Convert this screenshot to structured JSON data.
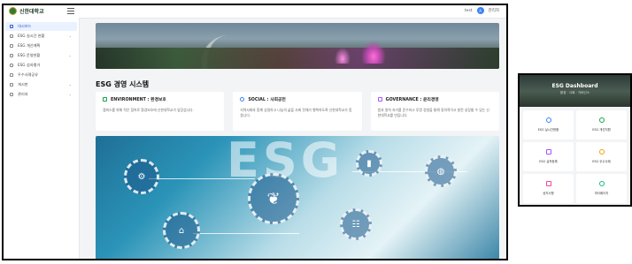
{
  "app": {
    "logo_text": "신한대학교",
    "user_name": "test",
    "user_role": "관리자",
    "avatar_text": "A"
  },
  "sidebar": {
    "items": [
      {
        "label": "대시보드",
        "icon": "dashboard-icon"
      },
      {
        "label": "ESG 실시간 현황",
        "icon": "pie-chart-icon"
      },
      {
        "label": "ESG 개선계획",
        "icon": "lightbulb-icon"
      },
      {
        "label": "ESG 운영현황",
        "icon": "document-icon"
      },
      {
        "label": "ESG 성과평가",
        "icon": "chart-icon"
      },
      {
        "label": "우수사례공유",
        "icon": "star-icon"
      },
      {
        "label": "게시판",
        "icon": "board-icon"
      },
      {
        "label": "관리자",
        "icon": "settings-icon"
      }
    ]
  },
  "main": {
    "section_title": "ESG 경영 시스템",
    "cards": [
      {
        "title": "ENVIRONMENT : 환경보호",
        "body": "캠퍼스를 위해 작은 참여로 환경보호에 신한대학교가 앞장섭니다.",
        "color": "#16a34a"
      },
      {
        "title": "SOCIAL : 사회공헌",
        "body": "지역사회와 함께 상생하고 나눔의 삶을 사회 전체가 행복하도록 신한대학교가 힘씁니다.",
        "color": "#3b82f6"
      },
      {
        "title": "GOVERNANCE : 윤리경영",
        "body": "법과 원칙 지키를 준수하고 투명 경영을 통해 정의적이고 발전 성장할 수 있는 신한대학교를 만듭니다.",
        "color": "#a855f7"
      }
    ],
    "banner_word": "ESG"
  },
  "mobile": {
    "title": "ESG Dashboard",
    "subtitle": "환경 · 사회 · 거버넌스",
    "tiles": [
      {
        "label": "ESG 실시간현황",
        "color": "#3b82f6"
      },
      {
        "label": "ESG 개선지원",
        "color": "#16a34a"
      },
      {
        "label": "ESG 실적등록",
        "color": "#a855f7"
      },
      {
        "label": "ESG 우수사례",
        "color": "#f59e0b"
      },
      {
        "label": "공지사항",
        "color": "#ec4899"
      },
      {
        "label": "마이페이지",
        "color": "#10b981"
      }
    ]
  }
}
